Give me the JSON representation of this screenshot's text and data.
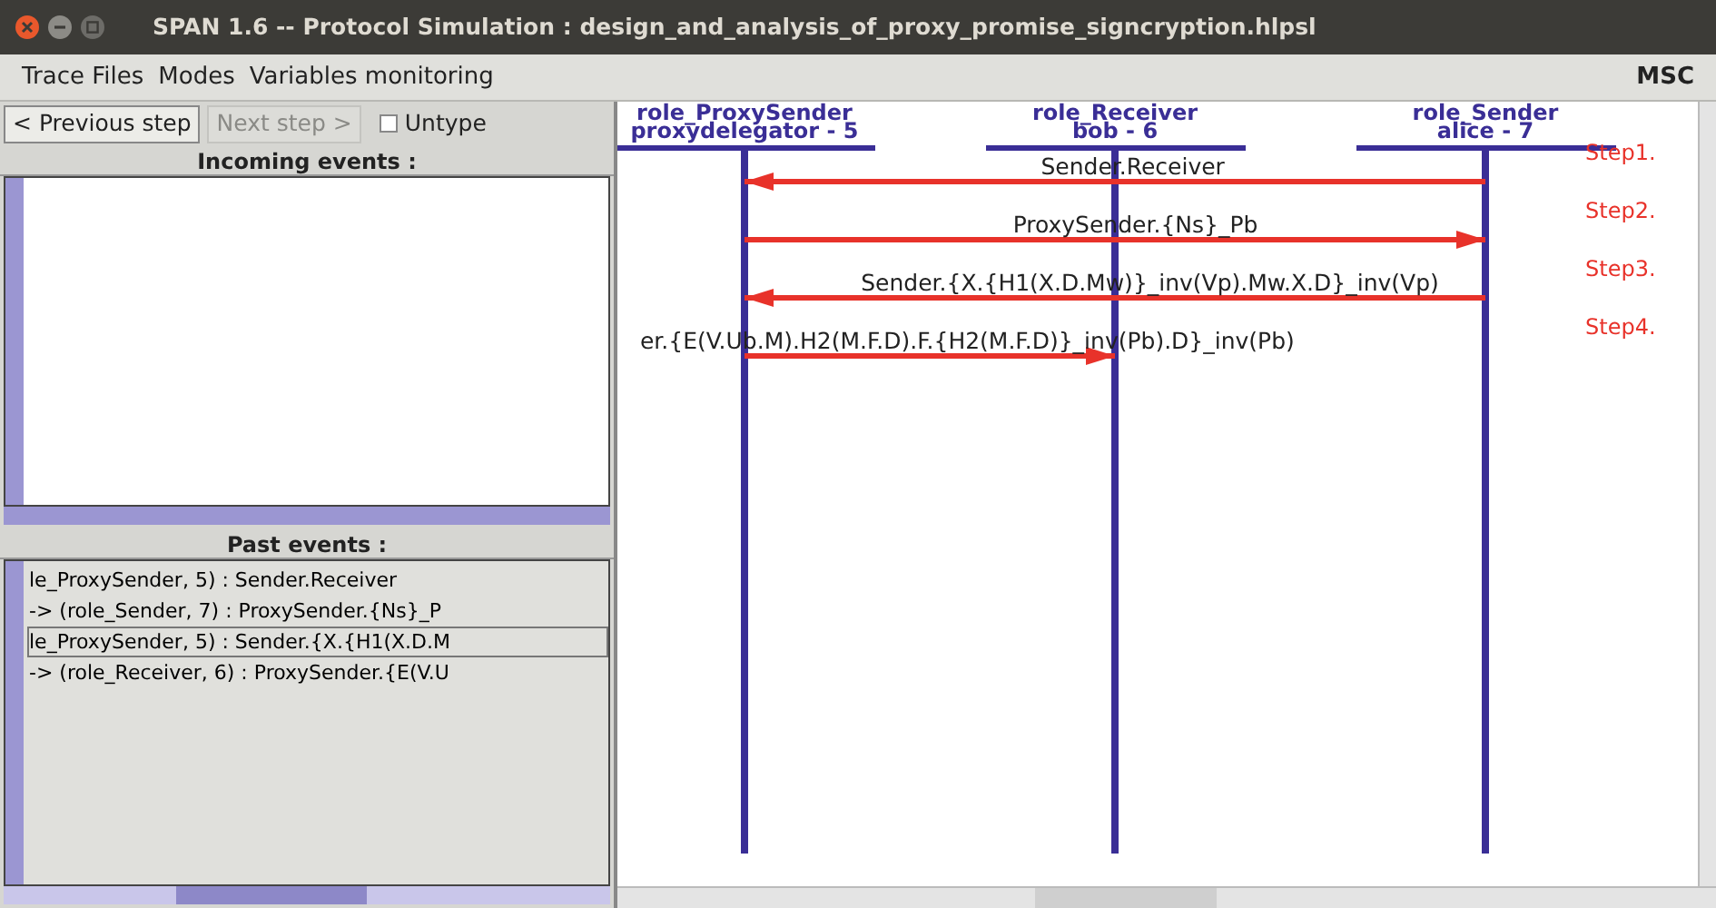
{
  "window": {
    "title": "SPAN 1.6 -- Protocol Simulation : design_and_analysis_of_proxy_promise_signcryption.hlpsl"
  },
  "menu": {
    "items": [
      "Trace Files",
      "Modes",
      "Variables monitoring"
    ],
    "right": "MSC"
  },
  "toolbar": {
    "buttons": [
      {
        "label": "< Previous step",
        "disabled": false
      },
      {
        "label": "Next step >",
        "disabled": true
      }
    ],
    "checkbox": {
      "label": "Untype",
      "checked": false
    }
  },
  "incoming_events": {
    "header": "Incoming events :"
  },
  "past_events": {
    "header": "Past events :",
    "items": [
      {
        "text": "le_ProxySender, 5) : Sender.Receiver",
        "selected": false
      },
      {
        "text": "-> (role_Sender, 7) : ProxySender.{Ns}_P",
        "selected": false
      },
      {
        "text": "le_ProxySender, 5) : Sender.{X.{H1(X.D.M",
        "selected": true
      },
      {
        "text": "-> (role_Receiver, 6) : ProxySender.{E(V.U",
        "selected": false
      }
    ]
  },
  "msc": {
    "roles": [
      {
        "name": "role_ProxySender",
        "agent": "proxydelegator - 5"
      },
      {
        "name": "role_Receiver",
        "agent": "bob - 6"
      },
      {
        "name": "role_Sender",
        "agent": "alice - 7"
      }
    ],
    "messages": [
      {
        "step": "Step1.",
        "text": "Sender.Receiver",
        "kind": "leftward"
      },
      {
        "step": "Step2.",
        "text": "ProxySender.{Ns}_Pb",
        "kind": "rightward"
      },
      {
        "step": "Step3.",
        "text": "Sender.{X.{H1(X.D.Mw)}_inv(Vp).Mw.X.D}_inv(Vp)",
        "kind": "leftward"
      },
      {
        "step": "Step4.",
        "text": "er.{E(V.Ub.M).H2(M.F.D).F.{H2(M.F.D)}_inv(Pb).D}_inv(Pb)",
        "kind": "halfway"
      }
    ]
  }
}
